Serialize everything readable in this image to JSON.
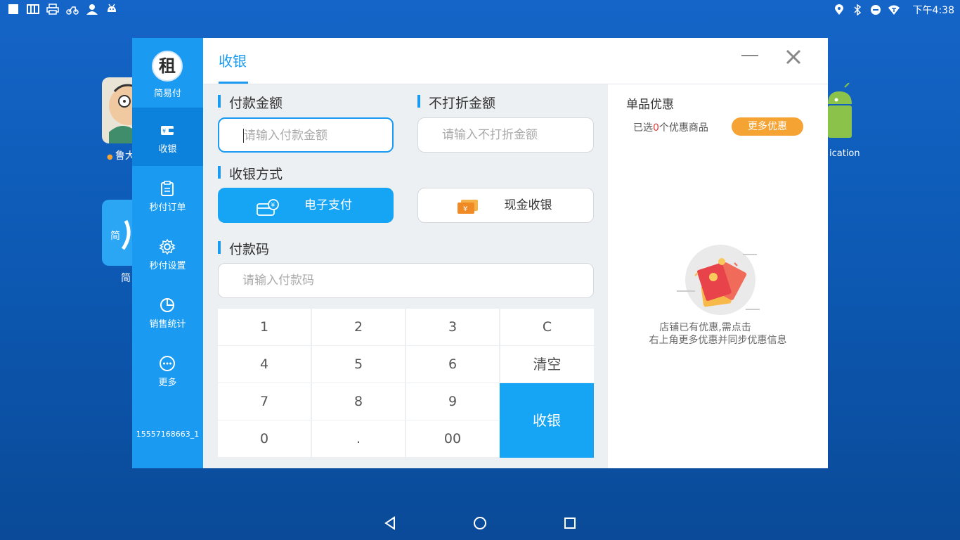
{
  "status_bar": {
    "time": "下午4:38",
    "left_icons": [
      "square-icon",
      "card-icon",
      "printer-icon",
      "scooter-icon",
      "person-icon",
      "android-icon"
    ],
    "right_icons": [
      "location-icon",
      "bluetooth-icon",
      "do-not-disturb-icon",
      "wifi-icon"
    ]
  },
  "desktop": {
    "apps": [
      {
        "label": "鲁大",
        "icon": "cartoon-face-icon"
      },
      {
        "label": "简",
        "icon": "jianyifu-app-icon"
      },
      {
        "label": "ication",
        "icon": "android-robot-icon"
      }
    ]
  },
  "sidebar": {
    "logo_glyph": "租",
    "app_name": "简易付",
    "items": [
      {
        "label": "收银",
        "icon": "wallet-icon",
        "active": true
      },
      {
        "label": "秒付订单",
        "icon": "clipboard-icon",
        "active": false
      },
      {
        "label": "秒付设置",
        "icon": "settings-icon",
        "active": false
      },
      {
        "label": "销售统计",
        "icon": "pie-chart-icon",
        "active": false
      },
      {
        "label": "更多",
        "icon": "more-icon",
        "active": false
      }
    ],
    "account": "15557168663_1"
  },
  "header": {
    "tab_title": "收银"
  },
  "form": {
    "amount_title": "付款金额",
    "amount_placeholder": "请输入付款金额",
    "nodiscount_title": "不打折金额",
    "nodiscount_placeholder": "请输入不打折金额",
    "method_title": "收银方式",
    "method_electronic": "电子支付",
    "method_cash": "现金收银",
    "code_title": "付款码",
    "code_placeholder": "请输入付款码"
  },
  "keypad": {
    "keys": [
      "1",
      "2",
      "3",
      "C",
      "4",
      "5",
      "6",
      "清空",
      "7",
      "8",
      "9",
      "0",
      ".",
      "00"
    ],
    "submit": "收银"
  },
  "promo": {
    "title": "单品优惠",
    "selected_prefix": "已选",
    "selected_count": "0",
    "selected_suffix": "个优惠商品",
    "more_button": "更多优惠",
    "empty_line1": "店铺已有优惠,需点击",
    "empty_line2": "右上角更多优惠并同步优惠信息"
  },
  "colors": {
    "primary": "#1a9af0",
    "accent_orange": "#f5a332",
    "highlight_red": "#e53935"
  }
}
